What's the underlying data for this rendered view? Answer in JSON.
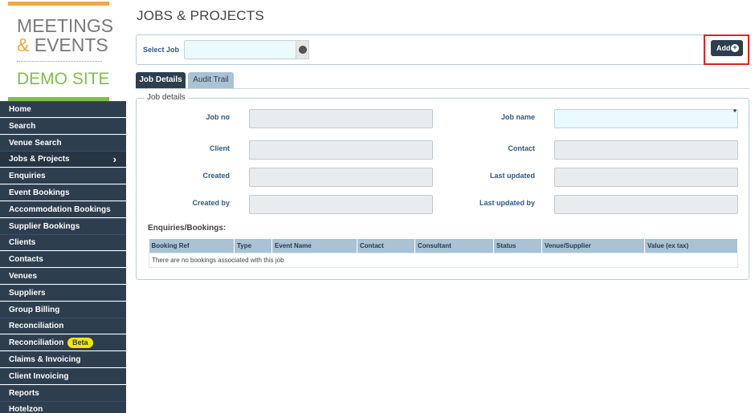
{
  "logo": {
    "line1": "MEETINGS",
    "line2_amp": "&",
    "line2": " EVENTS",
    "line3": "DEMO SITE"
  },
  "nav": {
    "items": [
      {
        "label": "Home"
      },
      {
        "label": "Search"
      },
      {
        "label": "Venue Search"
      },
      {
        "label": "Jobs & Projects",
        "active": true
      },
      {
        "label": "Enquiries"
      },
      {
        "label": "Event Bookings"
      },
      {
        "label": "Accommodation Bookings"
      },
      {
        "label": "Supplier Bookings"
      },
      {
        "label": "Clients"
      },
      {
        "label": "Contacts"
      },
      {
        "label": "Venues"
      },
      {
        "label": "Suppliers"
      },
      {
        "label": "Group Billing"
      },
      {
        "label": "Reconciliation"
      },
      {
        "label": "Reconciliation",
        "badge": "Beta"
      },
      {
        "label": "Claims & Invoicing"
      },
      {
        "label": "Client Invoicing"
      },
      {
        "label": "Reports"
      },
      {
        "label": "Hotelzon"
      }
    ],
    "chevron": "›"
  },
  "page": {
    "title": "JOBS & PROJECTS"
  },
  "select_job": {
    "label": "Select Job",
    "value": "",
    "globe_icon": "globe-icon"
  },
  "add_button": {
    "label": "Add",
    "icon": "+"
  },
  "tabs": [
    {
      "label": "Job Details"
    },
    {
      "label": "Audit Trail"
    }
  ],
  "job_details": {
    "legend": "Job details",
    "fields": {
      "job_no": "Job no",
      "job_name": "Job name",
      "client": "Client",
      "contact": "Contact",
      "created": "Created",
      "last_updated": "Last updated",
      "created_by": "Created by",
      "last_updated_by": "Last updated by"
    },
    "required_marker": "*"
  },
  "bookings": {
    "title": "Enquiries/Bookings:",
    "columns": [
      "Booking Ref",
      "Type",
      "Event Name",
      "Contact",
      "Consultant",
      "Status",
      "Venue/Supplier",
      "Value (ex tax)"
    ],
    "empty_message": "There are no bookings associated with this job"
  },
  "colors": {
    "nav_bg": "#2d3e4f",
    "accent_orange": "#f4a640",
    "accent_green": "#7cc04b",
    "label_blue": "#2e5a82",
    "highlight_red": "#e0232a",
    "badge_yellow": "#f3e600"
  }
}
